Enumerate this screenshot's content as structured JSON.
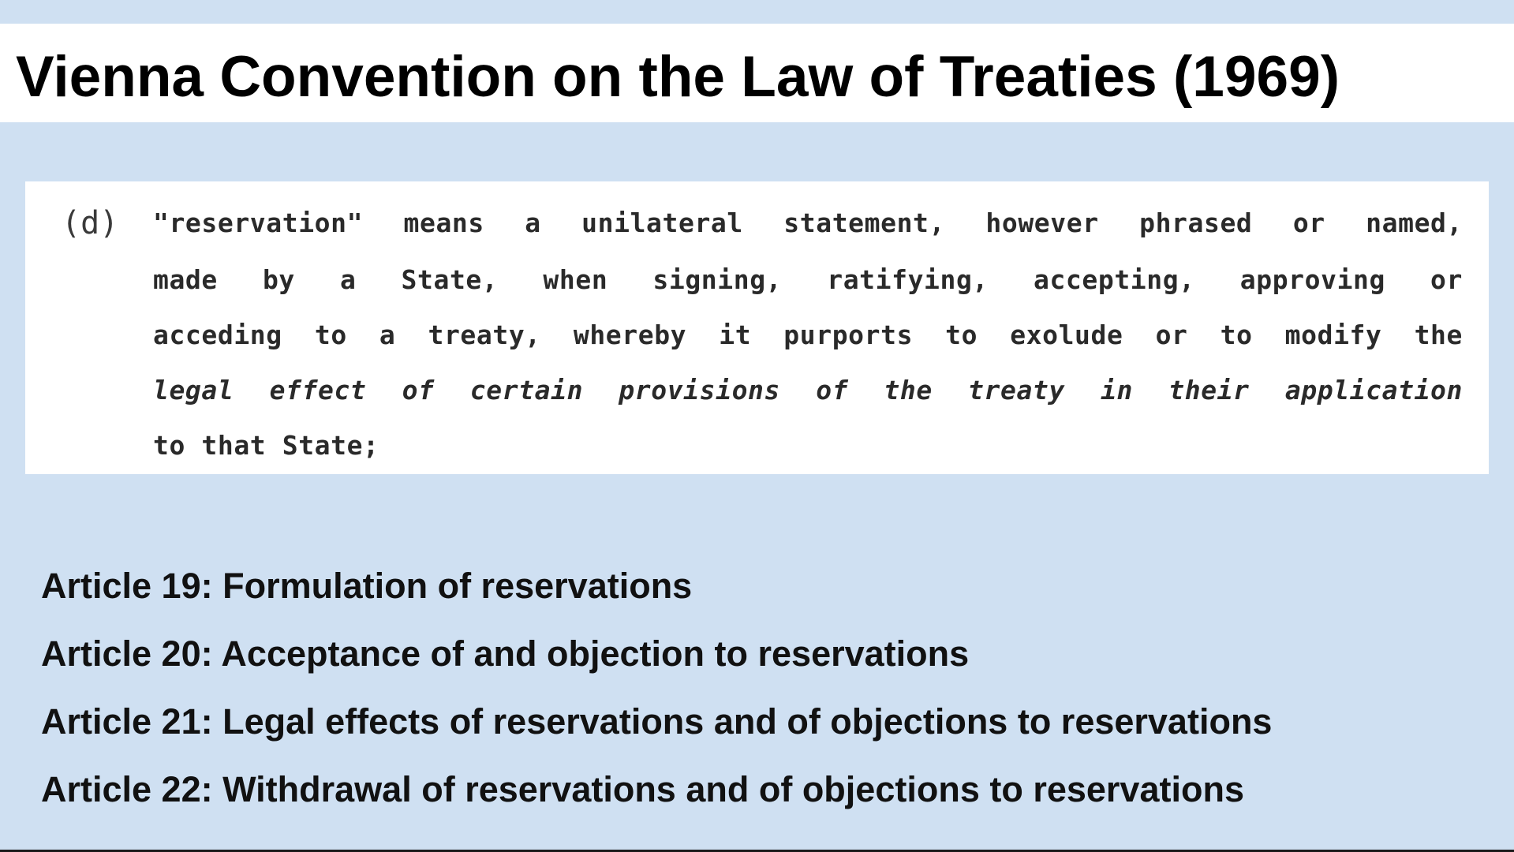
{
  "slide": {
    "title": "Vienna Convention on the Law of Treaties (1969)",
    "excerpt": {
      "marker": "(d)",
      "lines": [
        "\"reservation\" means a unilateral statement, however phrased or named,",
        "made by a State, when signing, ratifying, accepting, approving or",
        "acceding to a treaty, whereby it purports to exolude or to modify the",
        "legal effect of certain provisions of the treaty in their application",
        "to that State;"
      ]
    },
    "articles": [
      "Article 19: Formulation of reservations",
      "Article 20: Acceptance of and objection to reservations",
      "Article 21: Legal effects of reservations and of objections to reservations",
      "Article 22: Withdrawal of reservations and of objections to reservations"
    ]
  },
  "colors": {
    "background": "#cfe0f2",
    "panel": "#ffffff",
    "text": "#000000"
  }
}
